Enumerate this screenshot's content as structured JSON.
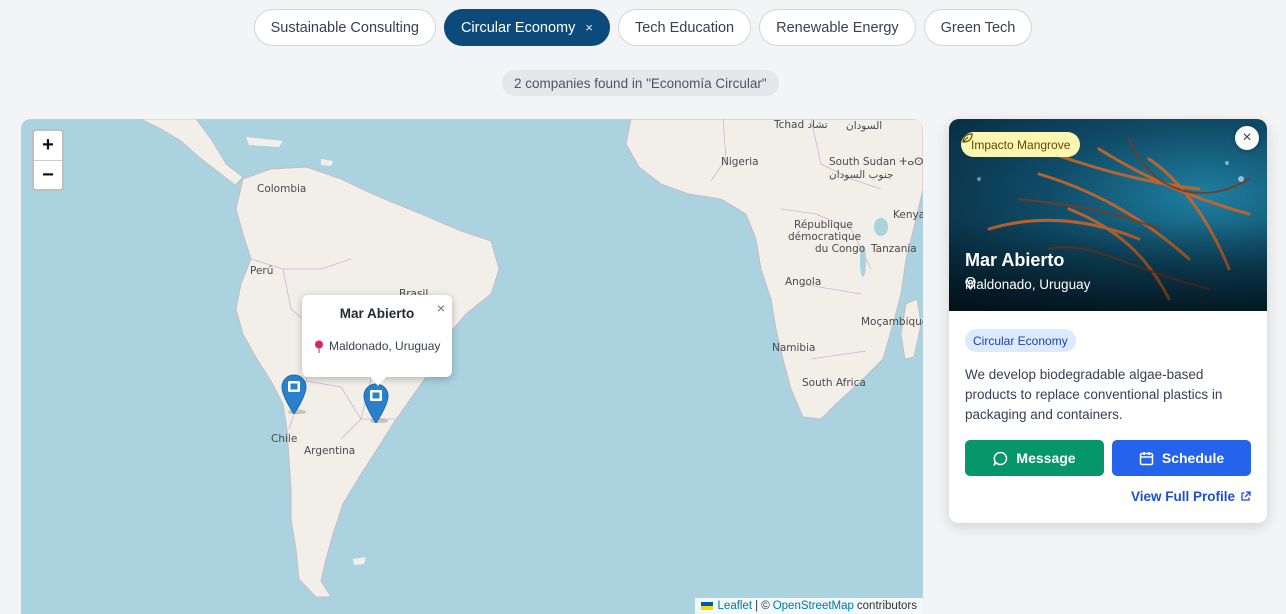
{
  "filters": [
    {
      "label": "Sustainable Consulting",
      "active": false
    },
    {
      "label": "Circular Economy",
      "active": true,
      "clear_glyph": "×"
    },
    {
      "label": "Tech Education",
      "active": false
    },
    {
      "label": "Renewable Energy",
      "active": false
    },
    {
      "label": "Green Tech",
      "active": false
    }
  ],
  "result_count": "2 companies found in \"Economía Circular\"",
  "map": {
    "zoom_in": "+",
    "zoom_out": "−",
    "labels": {
      "tchad": "Tchad تشاد",
      "sudan_ar": "السودان",
      "nigeria": "Nigeria",
      "south_sudan": "South Sudan ⵜⴰⵙⵓⴷⴰⵏ",
      "south_sudan_ar": "جنوب السودان",
      "colombia": "Colombia",
      "rdc1": "République",
      "rdc2": "démocratique",
      "rdc3": "du Congo",
      "kenya": "Kenya",
      "tanzania": "Tanzania",
      "peru": "Perú",
      "brasil": "Brasil",
      "angola": "Angola",
      "mocambique": "Moçambique",
      "namibia": "Namibia",
      "south_africa": "South Africa",
      "chile": "Chile",
      "argentina": "Argentina"
    },
    "popup": {
      "title": "Mar Abierto",
      "location": "Maldonado, Uruguay",
      "close": "×"
    },
    "attribution": {
      "leaflet": "Leaflet",
      "separator": "| ©",
      "osm": "OpenStreetMap",
      "contributors": "contributors"
    }
  },
  "card": {
    "badge": "Impacto Mangrove",
    "close": "×",
    "name": "Mar Abierto",
    "location": "Maldonado, Uruguay",
    "tag": "Circular Economy",
    "description": "We develop biodegradable algae-based products to replace conventional plastics in packaging and containers.",
    "message_label": "Message",
    "schedule_label": "Schedule",
    "profile_link": "View Full Profile"
  },
  "colors": {
    "active_chip": "#0b4a7a",
    "water": "#aad3df",
    "land": "#f2efe9",
    "marker": "#2a81cb",
    "message_btn": "#059669",
    "schedule_btn": "#2563eb"
  }
}
